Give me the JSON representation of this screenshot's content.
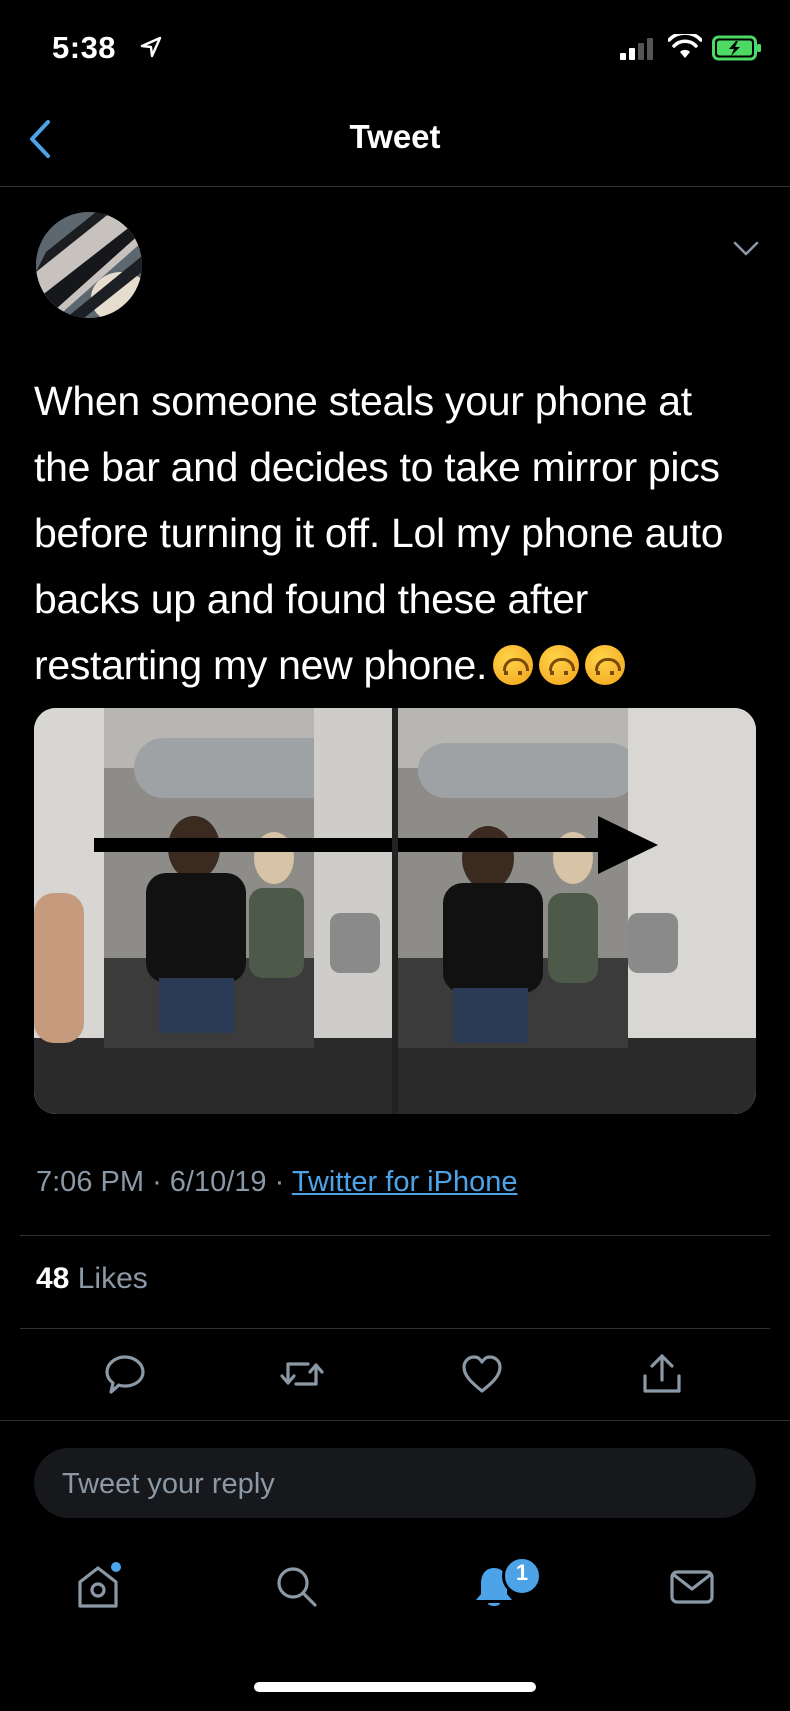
{
  "status": {
    "time": "5:38"
  },
  "nav": {
    "title": "Tweet"
  },
  "tweet": {
    "text_lines": [
      "When someone steals your phone at",
      "the bar and decides to take mirror pics",
      "before turning it off. Lol my phone auto",
      "backs up and found these after",
      "restarting my new phone."
    ],
    "time": "7:06 PM",
    "date": "6/10/19",
    "source": "Twitter for iPhone",
    "likes_count": "48",
    "likes_label": "Likes"
  },
  "reply": {
    "placeholder": "Tweet your reply"
  },
  "tabbar": {
    "notifications_badge": "1"
  },
  "colors": {
    "background": "#000000",
    "accent": "#4da3e8",
    "muted": "#8b98a5",
    "divider": "#2f3336"
  },
  "icons": [
    "location-arrow-icon",
    "signal-icon",
    "wifi-icon",
    "battery-icon",
    "back-chevron-icon",
    "caret-down-icon",
    "reply-icon",
    "retweet-icon",
    "like-icon",
    "share-icon",
    "home-icon",
    "search-icon",
    "notifications-icon",
    "messages-icon"
  ]
}
